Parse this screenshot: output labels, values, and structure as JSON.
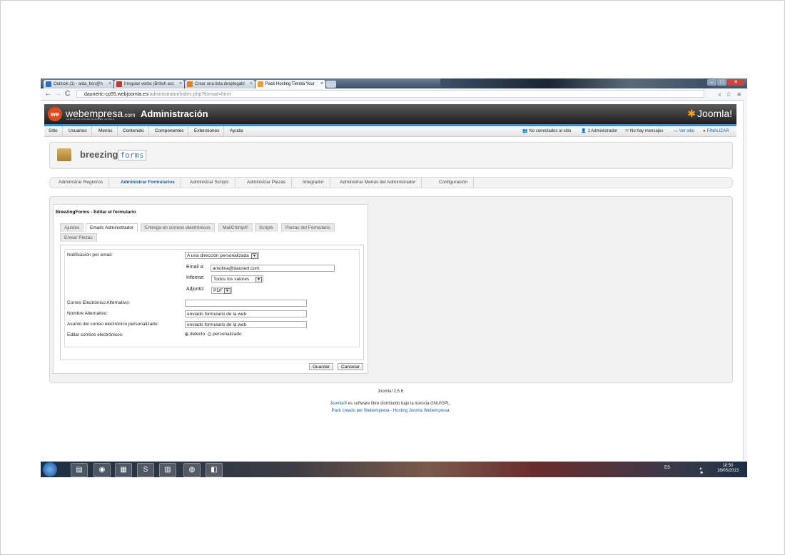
{
  "browser": {
    "tabs": [
      {
        "label": "Outlook (1) - aida_bcn@h",
        "fav_color": "#2a6fc0"
      },
      {
        "label": "Irregular verbs (British acc",
        "fav_color": "#c0392b"
      },
      {
        "label": "Crear una lista desplegabl",
        "fav_color": "#e67e22"
      },
      {
        "label": "Pack Hosting Tienda Your",
        "fav_color": "#f4a026"
      }
    ],
    "url_host": "daunertc-cp55.webjoomla.es",
    "url_path": "/administrator/index.php?format=html"
  },
  "header": {
    "brand": "webempresa",
    "brand_suffix": ".com",
    "brand_sub": "SERVICIOS PROFESIONALES JOOMLA",
    "title": "Administración",
    "joomla_logo": "Joomla!"
  },
  "menu": {
    "items": [
      "Sitio",
      "Usuarios",
      "Menús",
      "Contenido",
      "Componentes",
      "Extensiones",
      "Ayuda"
    ],
    "status": [
      {
        "icon": "users-icon",
        "text": "No conectados al sitio"
      },
      {
        "icon": "admin-icon",
        "text": "1 Administrador"
      },
      {
        "icon": "mail-icon",
        "text": "No hay mensajes"
      },
      {
        "icon": "view-site-icon",
        "text": "Ver sitio"
      },
      {
        "icon": "logout-icon",
        "text": "FINALIZAR"
      }
    ]
  },
  "component": {
    "logo_text": "breezing",
    "logo_forms": "forms"
  },
  "submenu": {
    "items": [
      "Administrar Registros",
      "Administrar Formularios",
      "Administrar Scripts",
      "Administrar Piezas",
      "Integrador",
      "Administrar Menús del Administrador",
      "Configuración"
    ],
    "active_index": 1
  },
  "form": {
    "title": "BreezingForms - Editar el formulario",
    "tabs": [
      "Ajustes",
      "Emails Administrador",
      "Entrega en correos electrónicos",
      "MailChimp®",
      "Scripts",
      "Piezas del Formulario",
      "Enviar Piezas"
    ],
    "active_tab": 1,
    "notification_label": "Notificación por email:",
    "notification_value": "A una dirección personalizada",
    "email_to_label": "Email a:",
    "email_to_value": "amolina@daunert.com",
    "report_label": "Informe:",
    "report_value": "Todos los valores",
    "attachment_label": "Adjunto:",
    "attachment_value": "PDF",
    "alt_email_label": "Correo Electrónico Alternativo:",
    "alt_email_value": "",
    "alt_name_label": "Nombre Alternativo:",
    "alt_name_value": "enviado formulario de la web",
    "subject_label": "Asunto del correo electrónico personalizado:",
    "subject_value": "enviado formulario de la web",
    "edit_emails_label": "Editar correos electrónicos:",
    "radio_default": "defecto",
    "radio_custom": "personalizado",
    "save_button": "Guardar",
    "cancel_button": "Cancelar"
  },
  "footer": {
    "version": "Joomla! 2.5.6",
    "license_link": "Joomla®",
    "license_text": " es software libre distribuido bajo la licencia GNU/GPL.",
    "pack_text": "Pack creado por Webempresa - Hosting Joomla Webempresa"
  },
  "taskbar": {
    "lang": "ES",
    "time": "10:50",
    "date": "16/05/2013"
  }
}
